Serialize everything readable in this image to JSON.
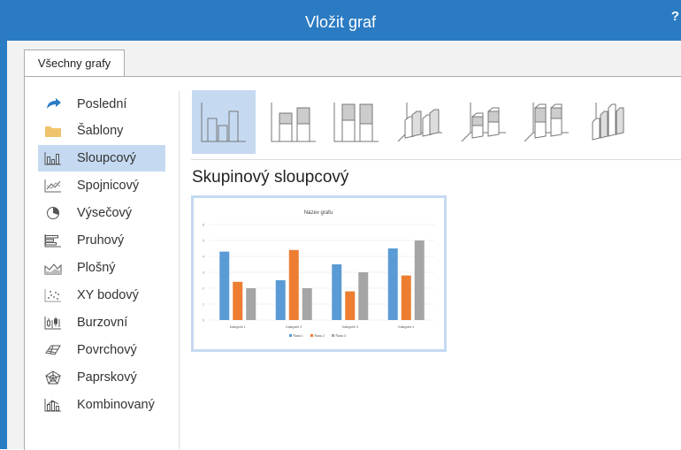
{
  "window": {
    "title": "Vložit graf",
    "help": "?"
  },
  "tabs": [
    {
      "label": "Všechny grafy"
    }
  ],
  "categories": [
    {
      "label": "Poslední",
      "icon": "recent-icon"
    },
    {
      "label": "Šablony",
      "icon": "folder-icon"
    },
    {
      "label": "Sloupcový",
      "icon": "column-chart-icon",
      "selected": true
    },
    {
      "label": "Spojnicový",
      "icon": "line-chart-icon"
    },
    {
      "label": "Výsečový",
      "icon": "pie-chart-icon"
    },
    {
      "label": "Pruhový",
      "icon": "bar-chart-icon"
    },
    {
      "label": "Plošný",
      "icon": "area-chart-icon"
    },
    {
      "label": "XY bodový",
      "icon": "scatter-chart-icon"
    },
    {
      "label": "Burzovní",
      "icon": "stock-chart-icon"
    },
    {
      "label": "Povrchový",
      "icon": "surface-chart-icon"
    },
    {
      "label": "Paprskový",
      "icon": "radar-chart-icon"
    },
    {
      "label": "Kombinovaný",
      "icon": "combo-chart-icon"
    }
  ],
  "subtypes": [
    {
      "name": "clustered-column",
      "selected": true
    },
    {
      "name": "stacked-column"
    },
    {
      "name": "100-stacked-column"
    },
    {
      "name": "3d-clustered-column"
    },
    {
      "name": "3d-stacked-column"
    },
    {
      "name": "3d-100-stacked-column"
    },
    {
      "name": "3d-column"
    }
  ],
  "selected_type_title": "Skupinový sloupcový",
  "colors": {
    "accent": "#2b7bc3",
    "selection": "#c5daf1",
    "series1": "#5b9bd5",
    "series2": "#ed7d31",
    "series3": "#a5a5a5"
  },
  "chart_data": {
    "type": "bar",
    "title": "Název grafu",
    "categories": [
      "Kategorie 1",
      "Kategorie 2",
      "Kategorie 3",
      "Kategorie 4"
    ],
    "series": [
      {
        "name": "Řada 1",
        "values": [
          4.3,
          2.5,
          3.5,
          4.5
        ]
      },
      {
        "name": "Řada 2",
        "values": [
          2.4,
          4.4,
          1.8,
          2.8
        ]
      },
      {
        "name": "Řada 3",
        "values": [
          2,
          2,
          3,
          5
        ]
      }
    ],
    "y_ticks": [
      "0",
      "1",
      "2",
      "3",
      "4",
      "5",
      "6"
    ],
    "ylim": [
      0,
      6
    ],
    "grid": true,
    "legend": "bottom"
  }
}
